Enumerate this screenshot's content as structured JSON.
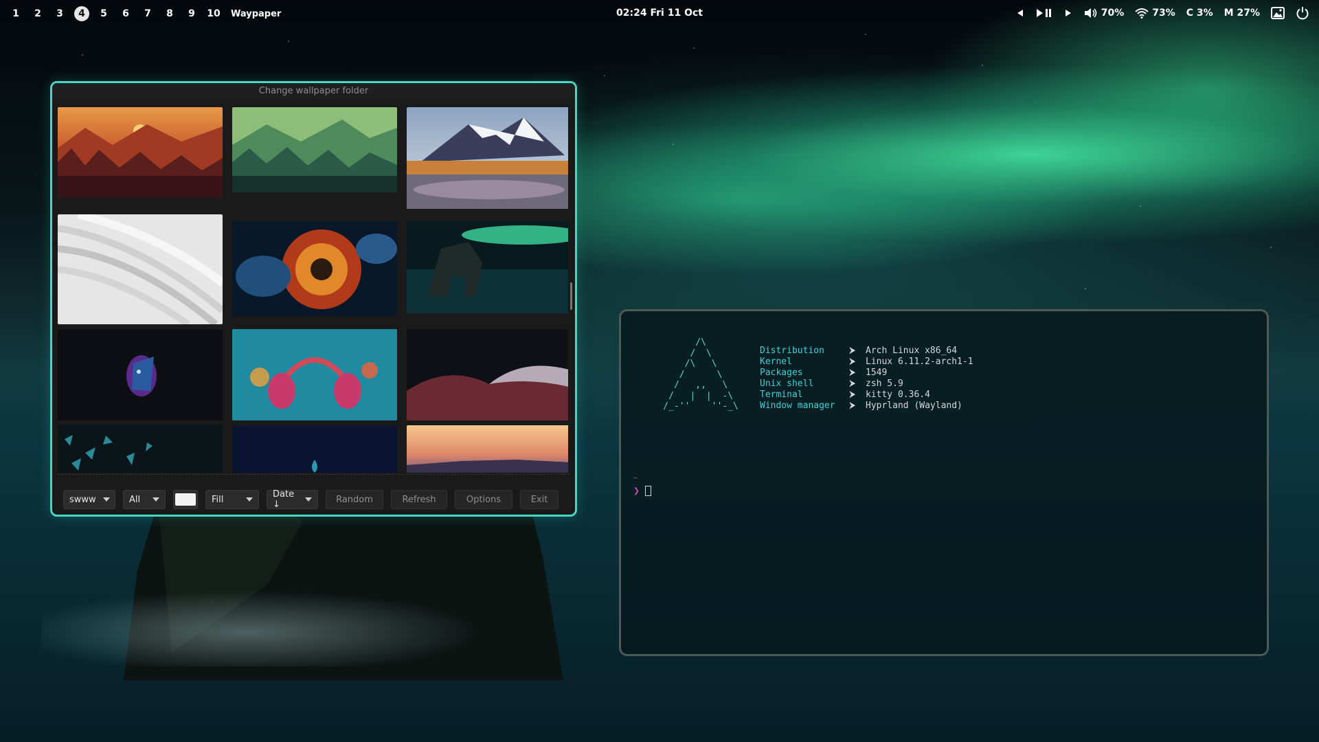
{
  "topbar": {
    "workspaces": [
      "1",
      "2",
      "3",
      "4",
      "5",
      "6",
      "7",
      "8",
      "9",
      "10"
    ],
    "active_workspace": "4",
    "window_title": "Waypaper",
    "clock": "02:24 Fri 11 Oct",
    "media": {
      "prev_icon": "skip-back-icon",
      "playpause_icon": "play-pause-icon",
      "next_icon": "skip-forward-icon"
    },
    "volume": {
      "icon": "speaker-icon",
      "value": "70%"
    },
    "wifi": {
      "icon": "wifi-icon",
      "value": "73%"
    },
    "cpu": "C 3%",
    "memory": "M 27%",
    "wallpaper_icon": "image-icon",
    "power_icon": "power-icon"
  },
  "waypaper": {
    "header": "Change wallpaper folder",
    "toolbar": {
      "backend": "swww",
      "filter": "All",
      "color_swatch": "#f2f2f2",
      "fill_mode": "Fill",
      "sort": "Date ↓",
      "random_label": "Random",
      "refresh_label": "Refresh",
      "options_label": "Options",
      "exit_label": "Exit"
    }
  },
  "terminal": {
    "ascii_logo": "          /\\\n         /  \\\n        /\\   \\\n       /      \\\n      /   ,,   \\\n     /   |  |  -\\\n    /_-''    ''-_\\",
    "info": [
      {
        "key": "Distribution",
        "value": "Arch Linux x86_64"
      },
      {
        "key": "Kernel",
        "value": "Linux 6.11.2-arch1-1"
      },
      {
        "key": "Packages",
        "value": "1549"
      },
      {
        "key": "Unix shell",
        "value": "zsh 5.9"
      },
      {
        "key": "Terminal",
        "value": "kitty 0.36.4"
      },
      {
        "key": "Window manager",
        "value": "Hyprland (Wayland)"
      }
    ],
    "separator": "⮞",
    "prompt_dir": "~",
    "prompt_symbol": "❯"
  },
  "colors": {
    "accent": "#49d6c4",
    "terminal_key": "#3fd2d8",
    "prompt": "#d04ab8"
  }
}
